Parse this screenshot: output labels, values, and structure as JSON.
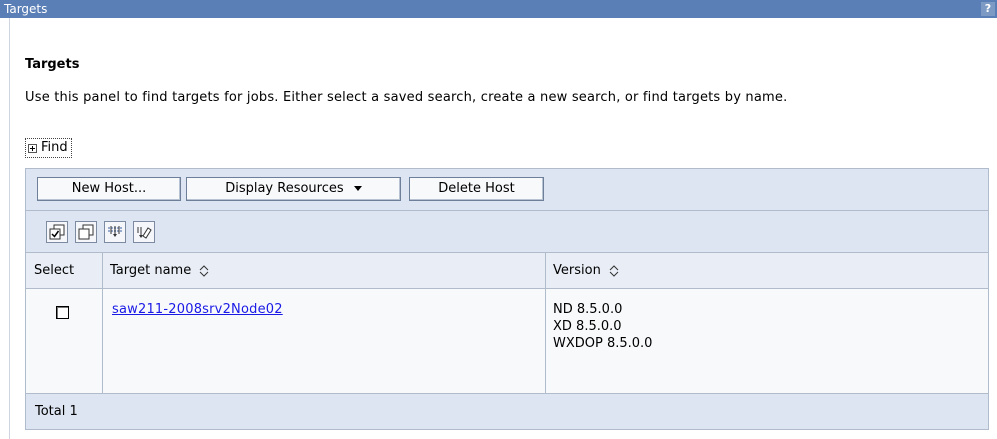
{
  "titlebar": {
    "title": "Targets",
    "help": "?"
  },
  "panel": {
    "heading": "Targets",
    "description": "Use this panel to find targets for jobs. Either select a saved search, create a new search, or find targets by name.",
    "find_label": "Find"
  },
  "buttons": {
    "new_host": "New Host...",
    "display_resources": "Display Resources",
    "delete_host": "Delete Host"
  },
  "icons": [
    "select-all-icon",
    "deselect-all-icon",
    "show-filter-icon",
    "clear-filter-icon"
  ],
  "table": {
    "columns": [
      "Select",
      "Target name",
      "Version"
    ],
    "rows": [
      {
        "selected": false,
        "target_name": "saw211-2008srv2Node02",
        "versions": [
          "ND 8.5.0.0",
          "XD 8.5.0.0",
          "WXDOP 8.5.0.0"
        ]
      }
    ],
    "total": "Total 1"
  },
  "colors": {
    "titlebar": "#5a7fb6",
    "link": "#1a1ae6",
    "toolbar": "#dde5f2"
  }
}
